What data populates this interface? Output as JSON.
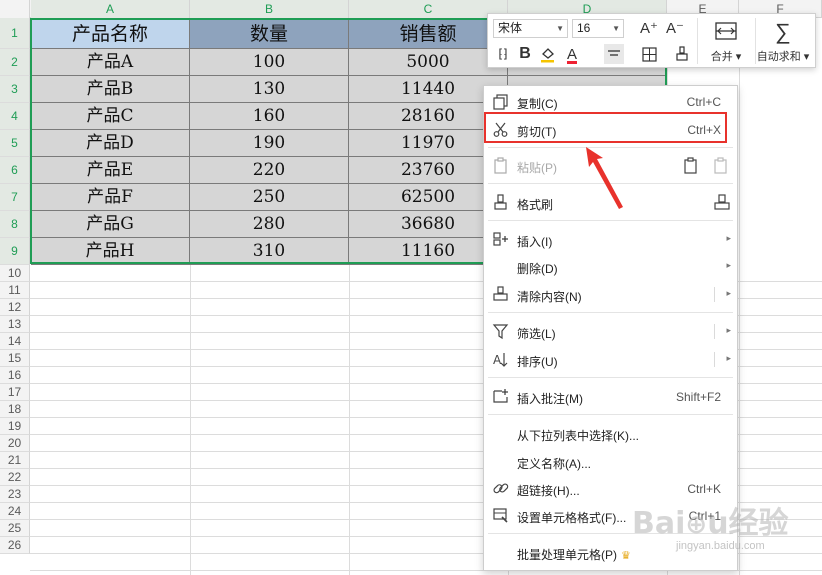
{
  "columns": [
    "A",
    "B",
    "C",
    "D",
    "E",
    "F"
  ],
  "rows": [
    "1",
    "2",
    "3",
    "4",
    "5",
    "6",
    "7",
    "8",
    "9",
    "10",
    "11",
    "12",
    "13",
    "14",
    "15",
    "16",
    "17",
    "18",
    "19",
    "20",
    "21",
    "22",
    "23",
    "24",
    "25",
    "26"
  ],
  "table": {
    "headers": [
      "产品名称",
      "数量",
      "销售额"
    ],
    "rows": [
      [
        "产品A",
        "100",
        "5000"
      ],
      [
        "产品B",
        "130",
        "11440"
      ],
      [
        "产品C",
        "160",
        "28160"
      ],
      [
        "产品D",
        "190",
        "11970"
      ],
      [
        "产品E",
        "220",
        "23760"
      ],
      [
        "产品F",
        "250",
        "62500"
      ],
      [
        "产品G",
        "280",
        "36680"
      ],
      [
        "产品H",
        "310",
        "11160"
      ]
    ]
  },
  "minibar": {
    "font": "宋体",
    "size": "16",
    "merge_label": "合并",
    "autosum_label": "自动求和"
  },
  "menu": {
    "copy": {
      "label": "复制(C)",
      "shortcut": "Ctrl+C"
    },
    "cut": {
      "label": "剪切(T)",
      "shortcut": "Ctrl+X"
    },
    "paste": {
      "label": "粘贴(P)"
    },
    "format_painter": {
      "label": "格式刷"
    },
    "insert": {
      "label": "插入(I)"
    },
    "delete": {
      "label": "删除(D)"
    },
    "clear": {
      "label": "清除内容(N)"
    },
    "filter": {
      "label": "筛选(L)"
    },
    "sort": {
      "label": "排序(U)"
    },
    "comment": {
      "label": "插入批注(M)",
      "shortcut": "Shift+F2"
    },
    "pick_list": {
      "label": "从下拉列表中选择(K)..."
    },
    "define_name": {
      "label": "定义名称(A)..."
    },
    "hyperlink": {
      "label": "超链接(H)...",
      "shortcut": "Ctrl+K"
    },
    "cell_format": {
      "label": "设置单元格格式(F)...",
      "shortcut": "Ctrl+1"
    },
    "batch": {
      "label": "批量处理单元格(P)"
    }
  },
  "watermark": {
    "text": "Baidu经验",
    "sub": "jingyan.baidu.com"
  },
  "colors": {
    "selection": "#1f9d55",
    "header_fill": "#8ea3bd",
    "first_header_fill": "#bfd5ec",
    "body_fill": "#d6d6d6",
    "highlight": "#e8322c"
  }
}
